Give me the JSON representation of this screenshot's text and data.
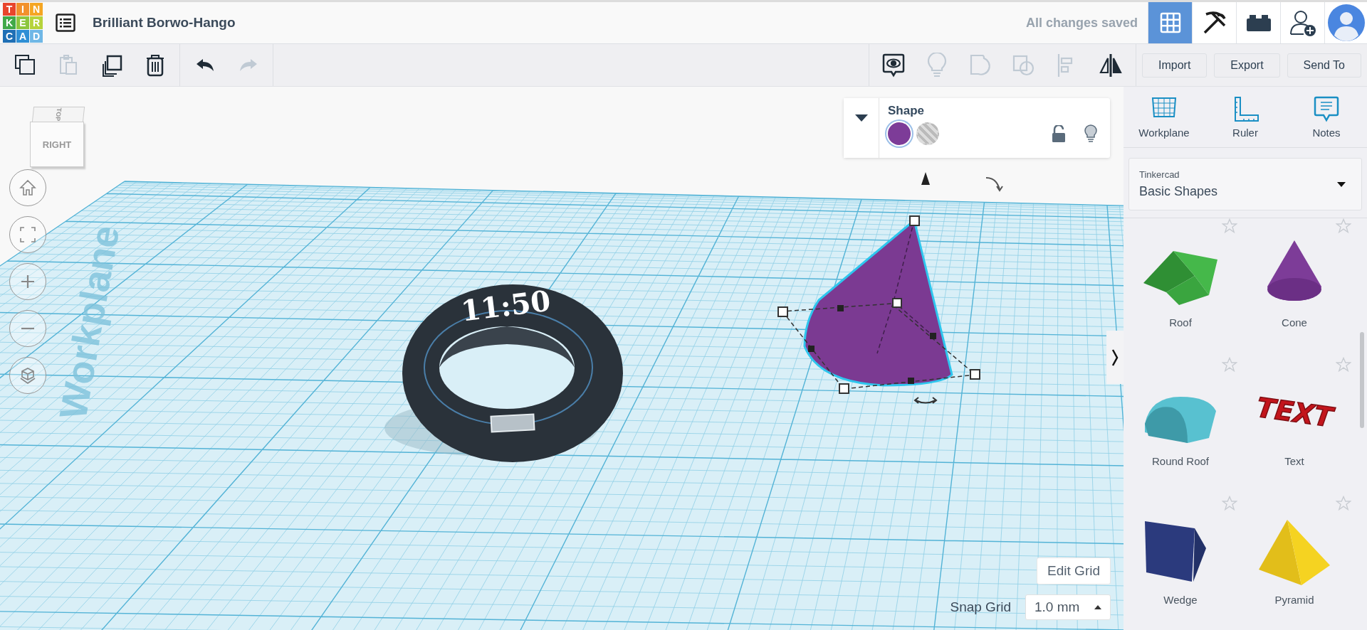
{
  "header": {
    "logo_letters": [
      "T",
      "I",
      "N",
      "K",
      "E",
      "R",
      "C",
      "A",
      "D"
    ],
    "title": "Brilliant Borwo-Hango",
    "save_status": "All changes saved",
    "nav": [
      {
        "kind": "grid",
        "selected": true
      },
      {
        "kind": "pickaxe",
        "selected": false
      },
      {
        "kind": "bricks",
        "selected": false
      },
      {
        "kind": "add-user",
        "selected": false
      },
      {
        "kind": "avatar",
        "selected": false
      }
    ]
  },
  "toolbar": {
    "edit_tools": [
      {
        "kind": "copy",
        "disabled": false
      },
      {
        "kind": "paste",
        "disabled": true
      },
      {
        "kind": "duplicate",
        "disabled": false
      },
      {
        "kind": "delete",
        "disabled": false
      }
    ],
    "history": [
      {
        "kind": "undo",
        "disabled": false
      },
      {
        "kind": "redo",
        "disabled": true
      }
    ],
    "view_tools": [
      {
        "kind": "notes",
        "disabled": false
      },
      {
        "kind": "bulb",
        "disabled": true
      },
      {
        "kind": "group",
        "disabled": true
      },
      {
        "kind": "ungroup",
        "disabled": true
      },
      {
        "kind": "align",
        "disabled": true
      },
      {
        "kind": "mirror",
        "disabled": false
      }
    ],
    "buttons": [
      "Import",
      "Export",
      "Send To"
    ]
  },
  "view_cube": {
    "top": "TOP",
    "front": "RIGHT"
  },
  "view_controls": [
    {
      "kind": "home"
    },
    {
      "kind": "fit"
    },
    {
      "kind": "zoom-in"
    },
    {
      "kind": "zoom-out"
    },
    {
      "kind": "perspective"
    }
  ],
  "workplane_label": "Workplane",
  "watch_text": "11:50",
  "shape_panel": {
    "title": "Shape",
    "options": [
      {
        "kind": "solid",
        "color": "#7d3c98",
        "selected": true
      },
      {
        "kind": "hole",
        "selected": false
      }
    ],
    "locked": false
  },
  "grid": {
    "edit_button": "Edit Grid",
    "snap_label": "Snap Grid",
    "snap_value": "1.0 mm"
  },
  "sidebar": {
    "tools": [
      {
        "kind": "workplane",
        "label": "Workplane"
      },
      {
        "kind": "ruler",
        "label": "Ruler"
      },
      {
        "kind": "notes",
        "label": "Notes"
      }
    ],
    "library": {
      "label": "Tinkercad",
      "value": "Basic Shapes"
    },
    "shapes": [
      {
        "kind": "roof",
        "label": "Roof",
        "favorite": false
      },
      {
        "kind": "cone",
        "label": "Cone",
        "favorite": false
      },
      {
        "kind": "round-roof",
        "label": "Round Roof",
        "favorite": false
      },
      {
        "kind": "text",
        "label": "Text",
        "preview_text": "TEXT",
        "favorite": false
      },
      {
        "kind": "wedge",
        "label": "Wedge",
        "favorite": false
      },
      {
        "kind": "pyramid",
        "label": "Pyramid",
        "favorite": false
      }
    ]
  }
}
